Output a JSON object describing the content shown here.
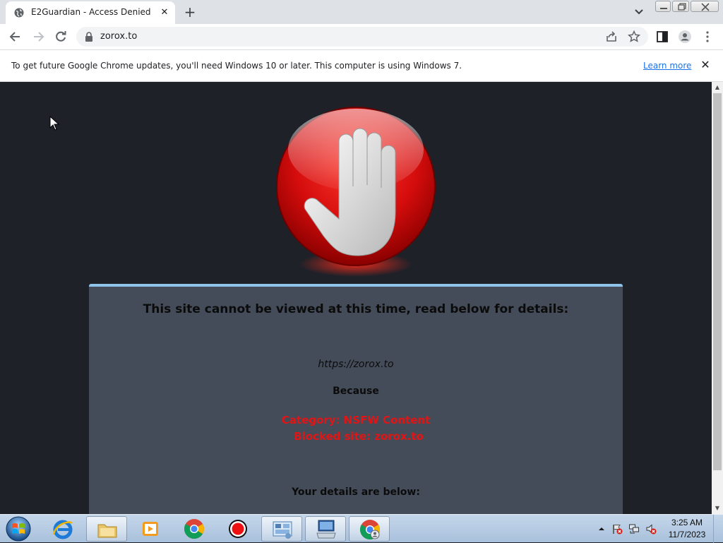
{
  "browser": {
    "tab": {
      "title": "E2Guardian - Access Denied"
    },
    "omnibox": {
      "url": "zorox.to"
    },
    "infobar": {
      "message": "To get future Google Chrome updates, you'll need Windows 10 or later. This computer is using Windows 7.",
      "link": "Learn more"
    }
  },
  "page": {
    "heading": "This site cannot be viewed at this time, read below for details:",
    "blocked_url": "https://zorox.to",
    "because": "Because",
    "category": "Category: NSFW Content",
    "blocked_site": "Blocked site: zorox.to",
    "details_heading": "Your details are below:"
  },
  "taskbar": {
    "apps": [
      "windows-explorer",
      "media-player",
      "google-chrome",
      "screen-recorder",
      "control-panel",
      "remote-desktop",
      "chrome-active"
    ],
    "clock": {
      "time": "3:25 AM",
      "date": "11/7/2023"
    }
  },
  "colors": {
    "page_background": "#1e2128",
    "panel_background": "#454c59",
    "panel_accent": "#8fc4ea",
    "block_reason": "#e01515"
  }
}
